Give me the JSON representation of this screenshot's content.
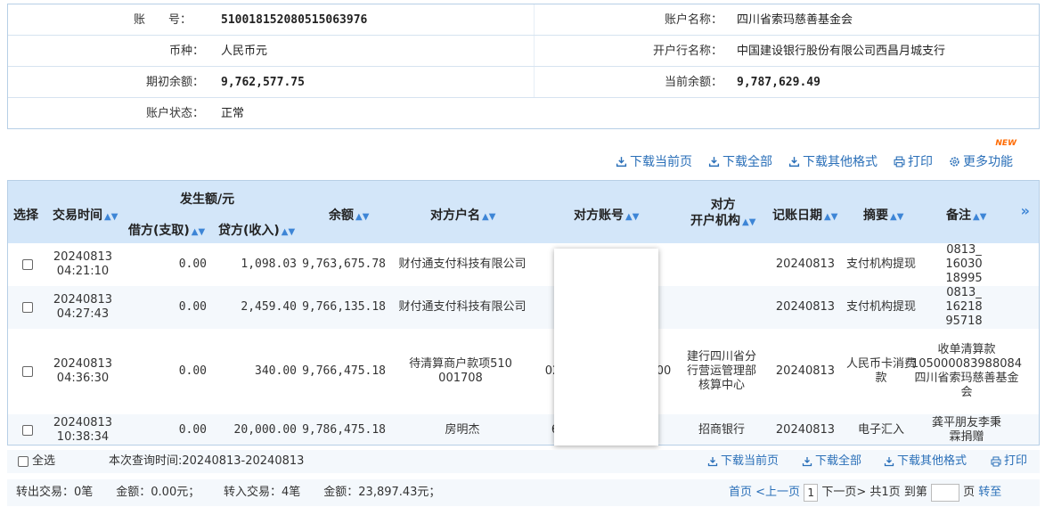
{
  "account": {
    "acct_no_label": "账　　号：",
    "acct_no": "510018152080515063976",
    "acct_name_label": "账户名称：",
    "acct_name": "四川省索玛慈善基金会",
    "currency_label": "币种：",
    "currency": "人民币元",
    "bank_label": "开户行名称：",
    "bank": "中国建设银行股份有限公司西昌月城支行",
    "opening_balance_label": "期初余额：",
    "opening_balance": "9,762,577.75",
    "current_balance_label": "当前余额：",
    "current_balance": "9,787,629.49",
    "status_label": "账户状态：",
    "status": "正常"
  },
  "toolbar": {
    "download_page": "下载当前页",
    "download_all": "下载全部",
    "download_other": "下载其他格式",
    "print": "打印",
    "more": "更多功能",
    "new_badge": "NEW"
  },
  "table": {
    "headers": {
      "select": "选择",
      "time": "交易时间",
      "amount_group": "发生额/元",
      "debit": "借方(支取)",
      "credit": "贷方(收入)",
      "balance": "余额",
      "party_name": "对方户名",
      "party_acct": "对方账号",
      "party_bank_1": "对方",
      "party_bank_2": "开户机构",
      "post_date": "记账日期",
      "summary": "摘要",
      "note": "备注",
      "more": "»"
    },
    "rows": [
      {
        "date": "20240813",
        "time": "04:21:10",
        "debit": "0.00",
        "credit": "1,098.03",
        "balance": "9,763,675.78",
        "party": "财付通支付科技有限公司",
        "party_acct": "",
        "party_bank": "",
        "post_date": "20240813",
        "summary": "支付机构提现",
        "note": "0813_1603018995"
      },
      {
        "date": "20240813",
        "time": "04:27:43",
        "debit": "0.00",
        "credit": "2,459.40",
        "balance": "9,766,135.18",
        "party": "财付通支付科技有限公司",
        "party_acct": "",
        "party_bank": "",
        "post_date": "20240813",
        "summary": "支付机构提现",
        "note": "0813_1621895718"
      },
      {
        "date": "20240813",
        "time": "04:36:30",
        "debit": "0.00",
        "credit": "340.00",
        "balance": "9,766,475.18",
        "party": "待清算商户款项510001708",
        "party_acct": "02",
        "party_acct_tail": "00",
        "party_bank": "建行四川省分行营运管理部核算中心",
        "post_date": "20240813",
        "summary": "人民币卡消费款",
        "note": "收单清算款105000083988084四川省索玛慈善基金会"
      },
      {
        "date": "20240813",
        "time": "10:38:34",
        "debit": "0.00",
        "credit": "20,000.00",
        "balance": "9,786,475.18",
        "party": "房明杰",
        "party_acct": "6",
        "party_bank": "招商银行",
        "post_date": "20240813",
        "summary": "电子汇入",
        "note": "龚平朋友李秉霖捐赠"
      }
    ]
  },
  "footer": {
    "select_all": "全选",
    "query_time": "本次查询时间:20240813-20240813",
    "out_summary": "转出交易：0笔　　金额：0.00元；",
    "in_summary": "转入交易：4笔　　金额：23,897.43元；",
    "first": "首页",
    "prev": "<上一页",
    "page": "1",
    "next": "下一页>",
    "total": "共1页",
    "goto_label": "到第",
    "page_unit": "页",
    "go": "转至"
  }
}
